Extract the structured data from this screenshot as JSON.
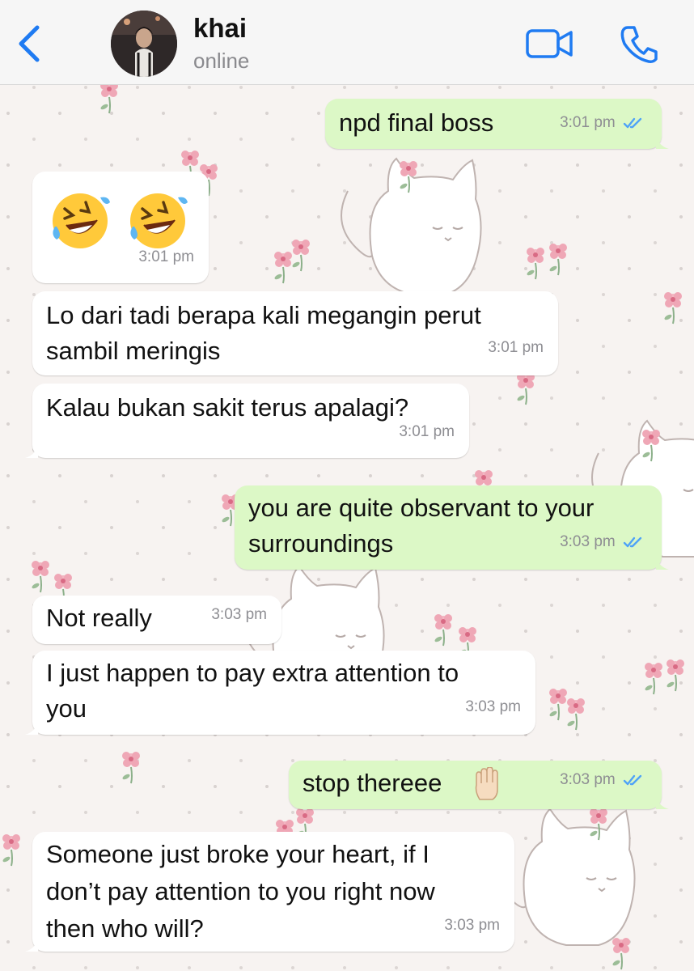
{
  "header": {
    "contact_name": "khai",
    "status": "online"
  },
  "colors": {
    "accent": "#1f7bf2",
    "incoming_bubble": "#ffffff",
    "outgoing_bubble": "#dcf8c6",
    "read_ticks": "#4fa3f7"
  },
  "messages": [
    {
      "direction": "out",
      "text": "npd final boss",
      "time": "3:01 pm",
      "status": "read"
    },
    {
      "direction": "in",
      "emoji": [
        "rolling-on-floor-laughing",
        "rolling-on-floor-laughing"
      ],
      "time": "3:01 pm"
    },
    {
      "direction": "in",
      "line1": "Lo dari tadi berapa kali megangin perut",
      "line2": "sambil meringis",
      "time": "3:01 pm"
    },
    {
      "direction": "in",
      "text": "Kalau bukan sakit terus apalagi?",
      "time": "3:01 pm"
    },
    {
      "direction": "out",
      "line1": "you are quite observant to your",
      "line2": "surroundings",
      "time": "3:03 pm",
      "status": "read"
    },
    {
      "direction": "in",
      "text": "Not really",
      "time": "3:03 pm"
    },
    {
      "direction": "in",
      "line1": "I just happen to pay extra attention to",
      "line2": "you",
      "time": "3:03 pm"
    },
    {
      "direction": "out",
      "text": "stop thereee",
      "emoji": "raised-hand",
      "time": "3:03 pm",
      "status": "read"
    },
    {
      "direction": "in",
      "line1": "Someone just broke your heart, if I",
      "line2": "don’t pay attention to you right now",
      "line3": "then who will?",
      "time": "3:03 pm"
    }
  ]
}
